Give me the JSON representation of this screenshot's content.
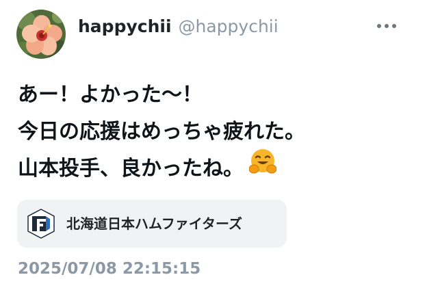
{
  "author": {
    "display_name": "happychii",
    "handle": "@happychii",
    "avatar_icon": "hibiscus-flower-avatar"
  },
  "post": {
    "lines": [
      "あー！よかった〜！",
      "今日の応援はめっちゃ疲れた。",
      "山本投手、良かったね。"
    ],
    "emoji": "hugging-face-icon"
  },
  "tag": {
    "label": "北海道日本ハムファイターズ",
    "icon": "fighters-logo-icon"
  },
  "timestamp": "2025/07/08 22:15:15",
  "menu": {
    "icon": "more-horizontal-icon"
  },
  "colors": {
    "text_primary": "#0f1419",
    "text_secondary": "#8b98a5",
    "chip_background": "#f1f2f4",
    "emoji_yellow": "#f9b52a"
  }
}
